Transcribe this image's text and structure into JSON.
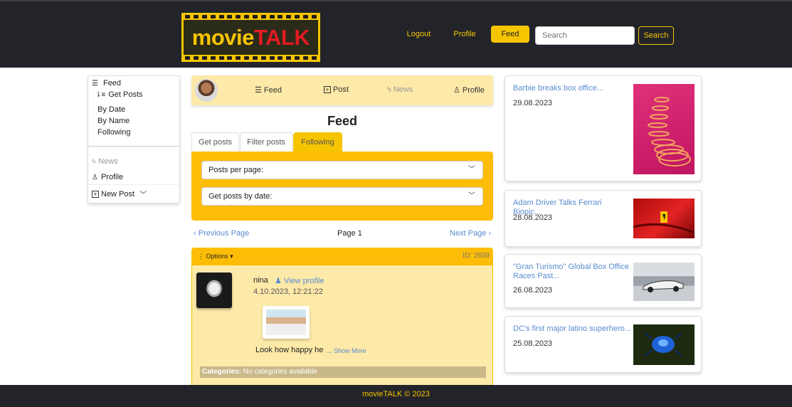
{
  "header": {
    "logo_part1": "movie",
    "logo_part2": "TALK",
    "nav_logout": "Logout",
    "nav_profile": "Profile",
    "nav_feed": "Feed",
    "search_placeholder": "Search",
    "search_button": "Search"
  },
  "sidebar": {
    "feed": "Feed",
    "get_posts": "Get Posts",
    "by_date": "By Date",
    "by_name": "By Name",
    "following": "Following",
    "news": "News",
    "profile": "Profile",
    "new_post": "New Post"
  },
  "profile_strip": {
    "feed": "Feed",
    "post": "Post",
    "news": "News",
    "profile": "Profile"
  },
  "main": {
    "title": "Feed",
    "tabs": [
      "Get posts",
      "Filter posts",
      "Following"
    ],
    "active_tab": "Following",
    "posts_per_page": "Posts per page:",
    "get_by_date": "Get posts by date:",
    "prev": "Previous Page",
    "page": "Page 1",
    "next": "Next Page"
  },
  "post": {
    "options": "Options",
    "id": "ID: 2609",
    "user": "nina",
    "view_profile": "View profile",
    "date": "4.10.2023, 12:21:22",
    "text": "Look how happy he",
    "show_more": "... Show More",
    "categories_label": "Categories:",
    "categories_value": "No categories available"
  },
  "news": [
    {
      "title": "Barbie breaks box office...",
      "date": "29.08.2023"
    },
    {
      "title": "Adam Driver Talks Ferrari Biopic...",
      "date": "28.08.2023"
    },
    {
      "title": "\"Gran Turismo\" Global Box Office Races Past...",
      "date": "26.08.2023"
    },
    {
      "title": "DC's first major latino superhero...",
      "date": "25.08.2023"
    }
  ],
  "footer": "movieTALK © 2023",
  "colors": {
    "accent": "#f6c500",
    "dark": "#222429",
    "link": "#5a8bd0"
  }
}
